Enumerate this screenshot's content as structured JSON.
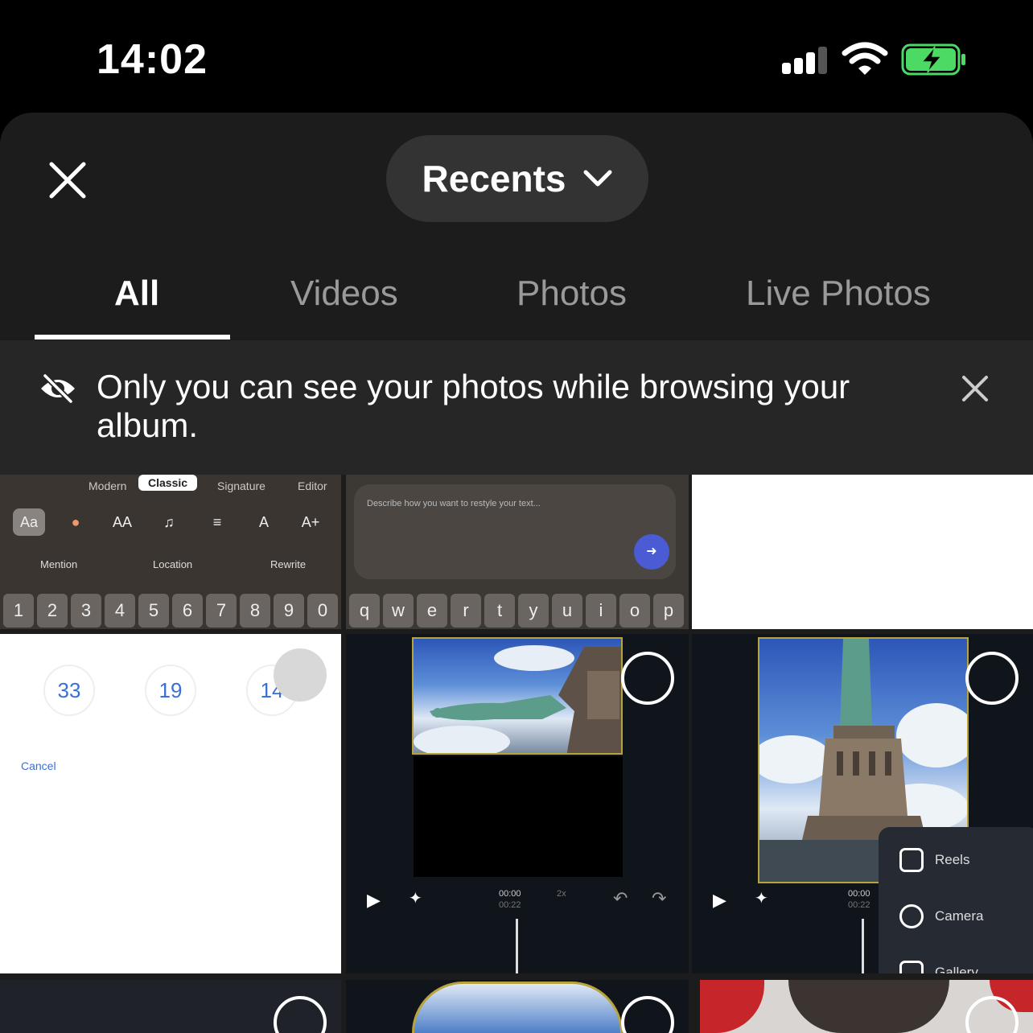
{
  "status_bar": {
    "time": "14:02",
    "icons": [
      "signal-icon",
      "wifi-icon",
      "battery-charging-icon"
    ],
    "battery_color": "#4cd964"
  },
  "header": {
    "close_icon": "close-icon",
    "album_label": "Recents",
    "album_icon": "chevron-down-icon"
  },
  "tabs": [
    {
      "label": "All",
      "active": true
    },
    {
      "label": "Videos",
      "active": false
    },
    {
      "label": "Photos",
      "active": false
    },
    {
      "label": "Live Photos",
      "active": false
    }
  ],
  "privacy_banner": {
    "icon": "eye-slash-icon",
    "text": "Only you can see your photos while browsing your album.",
    "close_icon": "close-icon"
  },
  "grid": {
    "tile_keyboard": {
      "modes": [
        "Modern",
        "Classic",
        "Signature",
        "Editor"
      ],
      "selected_mode": "Classic",
      "tools": [
        "Aa",
        "●",
        "AA",
        "♫",
        "≡",
        "A",
        "A+"
      ],
      "chips": [
        "Mention",
        "Location",
        "Rewrite"
      ],
      "number_keys": [
        "1",
        "2",
        "3",
        "4",
        "5",
        "6",
        "7",
        "8",
        "9",
        "0"
      ]
    },
    "tile_restyle": {
      "placeholder": "Describe how you want to restyle your text...",
      "send_icon": "arrow-right-icon",
      "letter_keys": [
        "q",
        "w",
        "e",
        "r",
        "t",
        "y",
        "u",
        "i",
        "o",
        "p"
      ]
    },
    "tile_datepicker": {
      "dates": [
        "33",
        "19",
        "14"
      ],
      "cancel": "Cancel"
    },
    "tile_video_1": {
      "time_current": "00:00",
      "time_total": "00:22",
      "speed": "2x"
    },
    "tile_video_2": {
      "time_current": "00:00",
      "time_total": "00:22",
      "menu": [
        "Reels",
        "Camera",
        "Gallery"
      ]
    }
  }
}
